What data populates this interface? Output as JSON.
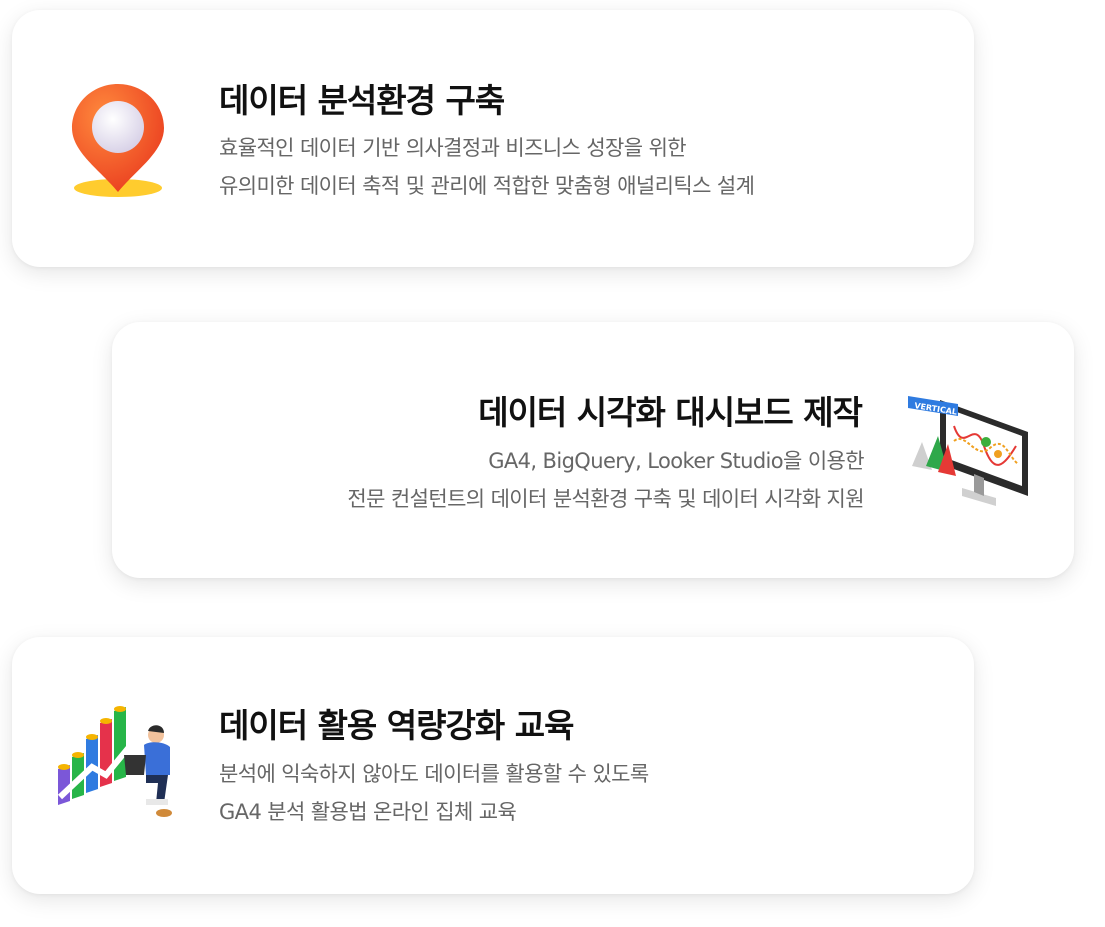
{
  "cards": [
    {
      "title": "데이터 분석환경 구축",
      "lines": [
        "효율적인 데이터 기반 의사결정과 비즈니스 성장을 위한",
        "유의미한 데이터 축적 및 관리에 적합한 맞춤형 애널리틱스 설계"
      ],
      "icon": "location-pin-icon"
    },
    {
      "title": "데이터 시각화 대시보드 제작",
      "lines": [
        "GA4, BigQuery, Looker Studio을 이용한",
        "전문 컨설턴트의 데이터 분석환경 구축 및 데이터 시각화 지원"
      ],
      "icon": "monitor-chart-icon",
      "icon_badge": "VERTICAL"
    },
    {
      "title": "데이터 활용 역량강화 교육",
      "lines": [
        "분석에 익숙하지 않아도 데이터를 활용할 수 있도록",
        "GA4 분석 활용법 온라인 집체 교육"
      ],
      "icon": "analyst-growth-chart-icon"
    }
  ],
  "colors": {
    "title": "#111111",
    "description": "#666666",
    "pin": "#f0502a",
    "accent_blue": "#2f7be0"
  }
}
